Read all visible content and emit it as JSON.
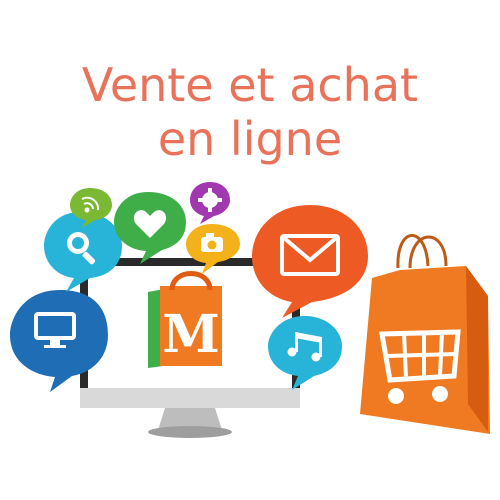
{
  "headline": {
    "line1": "Vente et achat",
    "line2": "en ligne"
  },
  "logo": {
    "letter": "M"
  },
  "icons": [
    "wifi-icon",
    "heart-icon",
    "settings-icon",
    "search-icon",
    "camera-icon",
    "mail-icon",
    "monitor-icon",
    "music-icon",
    "shopping-cart-icon",
    "shopping-bag-icon"
  ],
  "colors": {
    "title": "#e8735a",
    "orange": "#f07a22",
    "green": "#3fae49",
    "blue": "#1f6db5",
    "cyan": "#28b3d8",
    "purple": "#a238b0",
    "red_orange": "#ee5a24",
    "yellow": "#f3b21a"
  }
}
